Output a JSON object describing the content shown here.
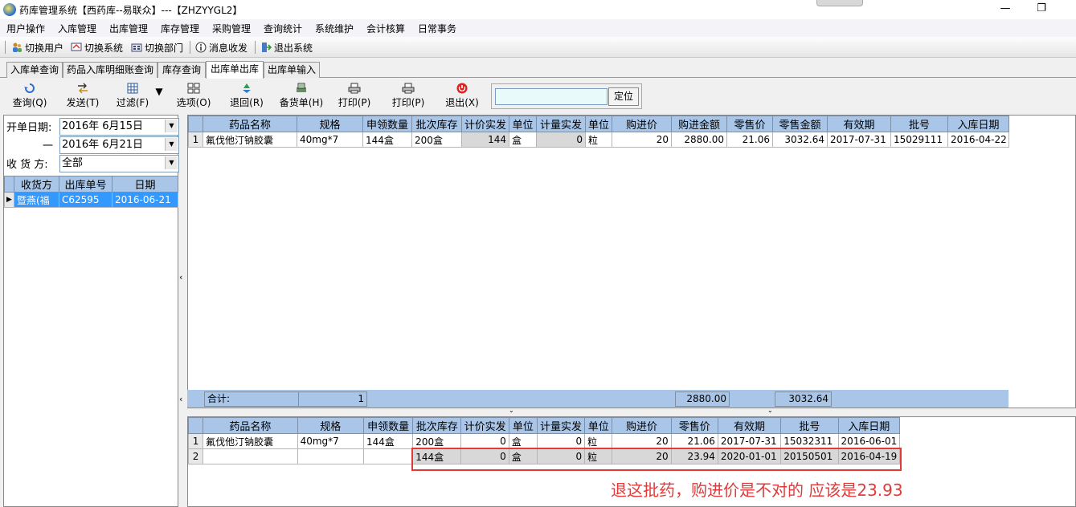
{
  "window": {
    "title": "药库管理系统【西药库--易联众】---【ZHZYYGL2】",
    "minimize": "—",
    "restore": "❐"
  },
  "menu": [
    "用户操作",
    "入库管理",
    "出库管理",
    "库存管理",
    "采购管理",
    "查询统计",
    "系统维护",
    "会计核算",
    "日常事务"
  ],
  "toolbar": {
    "switch_user": "切换用户",
    "switch_system": "切换系统",
    "switch_dept": "切换部门",
    "messages": "消息收发",
    "exit_system": "退出系统"
  },
  "tabs": [
    "入库单查询",
    "药品入库明细账查询",
    "库存查询",
    "出库单出库",
    "出库单输入"
  ],
  "active_tab": 3,
  "buttons": {
    "query": "查询(Q)",
    "send": "发送(T)",
    "filter": "过滤(F)",
    "options": "选项(O)",
    "return": "退回(R)",
    "stock_slip": "备货单(H)",
    "print1": "打印(P)",
    "print2": "打印(P)",
    "exit": "退出(X)",
    "locate": "定位"
  },
  "search": {
    "value": ""
  },
  "filters": {
    "start_label": "开单日期:",
    "start_value": "2016年 6月15日",
    "end_label": "一",
    "end_value": "2016年 6月21日",
    "receiver_label": "收 货 方:",
    "receiver_value": "全部"
  },
  "order_list": {
    "columns": [
      "收货方",
      "出库单号",
      "日期"
    ],
    "rows": [
      {
        "receiver": "暨燕(福",
        "no": "C62595",
        "date": "2016-06-21"
      }
    ]
  },
  "top_grid": {
    "columns": [
      "药品名称",
      "规格",
      "申领数量",
      "批次库存",
      "计价实发",
      "单位",
      "计量实发",
      "单位",
      "购进价",
      "购进金额",
      "零售价",
      "零售金额",
      "有效期",
      "批号",
      "入库日期"
    ],
    "rows": [
      {
        "idx": "1",
        "name": "氟伐他汀钠胶囊",
        "spec": "40mg*7",
        "req": "144盒",
        "batch": "200盒",
        "price_qty": "144",
        "unit1": "盒",
        "meas_qty": "0",
        "unit2": "粒",
        "cost": "20",
        "cost_amt": "2880.00",
        "retail": "21.06",
        "retail_amt": "3032.64",
        "expiry": "2017-07-31",
        "lot": "15029111",
        "in_date": "2016-04-22"
      }
    ],
    "summary": {
      "label": "合计:",
      "qty": "1",
      "cost_amt": "2880.00",
      "retail_amt": "3032.64"
    }
  },
  "bottom_grid": {
    "columns": [
      "药品名称",
      "规格",
      "申领数量",
      "批次库存",
      "计价实发",
      "单位",
      "计量实发",
      "单位",
      "购进价",
      "零售价",
      "有效期",
      "批号",
      "入库日期"
    ],
    "rows": [
      {
        "idx": "1",
        "name": "氟伐他汀钠胶囊",
        "spec": "40mg*7",
        "req": "144盒",
        "batch": "200盒",
        "price_qty": "0",
        "unit1": "盒",
        "meas_qty": "0",
        "unit2": "粒",
        "cost": "20",
        "retail": "21.06",
        "expiry": "2017-07-31",
        "lot": "15032311",
        "in_date": "2016-06-01"
      },
      {
        "idx": "2",
        "name": "",
        "spec": "",
        "req": "",
        "batch": "144盒",
        "price_qty": "0",
        "unit1": "盒",
        "meas_qty": "0",
        "unit2": "粒",
        "cost": "20",
        "retail": "23.94",
        "expiry": "2020-01-01",
        "lot": "20150501",
        "in_date": "2016-04-19"
      }
    ]
  },
  "annotation": {
    "text": "退这批药，购进价是不对的   应该是23.93",
    "color": "#e03a3a"
  }
}
